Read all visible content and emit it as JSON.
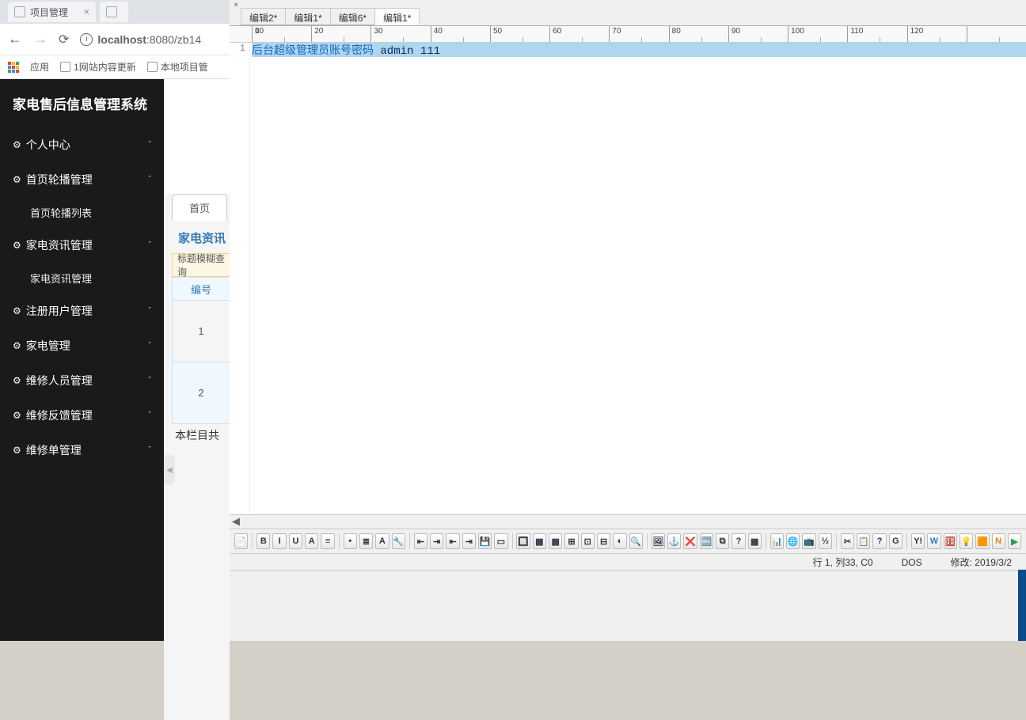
{
  "browser": {
    "tab_title": "项目管理",
    "url_host": "localhost",
    "url_port_path": ":8080/zb14",
    "apps_label": "应用",
    "bookmark1": "1网站内容更新",
    "bookmark2": "本地项目管"
  },
  "admin": {
    "title": "家电售后信息管理系统",
    "menu": {
      "personal": "个人中心",
      "carousel_mgmt": "首页轮播管理",
      "carousel_list": "首页轮播列表",
      "news_mgmt": "家电资讯管理",
      "news_sub": "家电资讯管理",
      "user_mgmt": "注册用户管理",
      "appliance_mgmt": "家电管理",
      "repair_staff": "维修人员管理",
      "feedback_mgmt": "维修反馈管理",
      "order_mgmt": "维修单管理"
    },
    "content": {
      "home_tab": "首页",
      "section_title": "家电资讯",
      "filter_label": "标题模糊查询",
      "th_id": "编号",
      "row1": "1",
      "row2": "2",
      "footer": "本栏目共"
    }
  },
  "editor": {
    "tabs": {
      "t1": "编辑2*",
      "t2": "编辑1*",
      "t3": "编辑6*",
      "t4": "编辑1*"
    },
    "ruler": [
      "0",
      "10",
      "20",
      "30",
      "40",
      "50",
      "60",
      "70",
      "80",
      "90",
      "100",
      "110",
      "120"
    ],
    "line_number": "1",
    "code_prefix": "后台超级管理员账号密码 ",
    "code_suffix": "admin 111",
    "status": {
      "position": "行 1, 列33, C0",
      "encoding": "DOS",
      "modified": "修改:  2019/3/2"
    },
    "toolbar_icons": [
      "📄",
      "B",
      "I",
      "U",
      "A",
      "≡",
      "•",
      "≣",
      "A",
      "🔧",
      "⇤",
      "⇥",
      "⇤",
      "⇥",
      "💾",
      "▭",
      "🔲",
      "▦",
      "▦",
      "⊞",
      "⊡",
      "⊟",
      "◐",
      "🔍",
      "🖼",
      "⚓",
      "❌",
      "🔤",
      "⧉",
      "?",
      "▦",
      "📊",
      "🌐",
      "📺",
      "½",
      "✂",
      "📋",
      "?",
      "G",
      "Y!",
      "W",
      "🗄",
      "💡",
      "🟧",
      "N",
      "▶"
    ]
  }
}
